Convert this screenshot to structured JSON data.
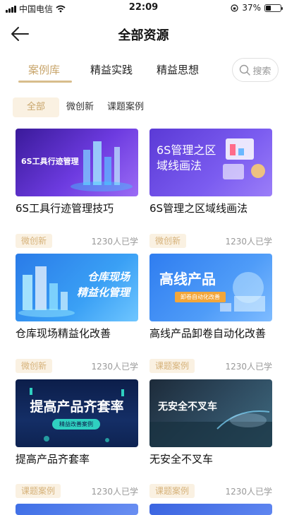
{
  "status_bar": {
    "carrier": "中国电信",
    "time": "22:09",
    "battery_pct": "37%",
    "battery_level": 0.37
  },
  "nav": {
    "title": "全部资源"
  },
  "tabs": [
    {
      "label": "案例库"
    },
    {
      "label": "精益实践"
    },
    {
      "label": "精益思想"
    }
  ],
  "search": {
    "placeholder": "搜索"
  },
  "filters": [
    {
      "label": "全部"
    },
    {
      "label": "微创新"
    },
    {
      "label": "课题案例"
    }
  ],
  "cards": [
    {
      "title": "6S工具行迹管理技巧",
      "thumb_text": "6S工具行迹管理",
      "tag": "",
      "learners": ""
    },
    {
      "title": "6S管理之区域线画法",
      "thumb_text": "6S管理之区\n域线画法",
      "tag": "",
      "learners": ""
    },
    {
      "title": "仓库现场精益化改善",
      "thumb_text": "仓库现场\n精益化管理",
      "tag": "微创新",
      "learners": "1230人已学"
    },
    {
      "title": "高线产品卸卷自动化改善",
      "thumb_text": "高线产品",
      "thumb_sub": "卸卷自动化改善",
      "tag": "微创新",
      "learners": "1230人已学"
    },
    {
      "title": "提高产品齐套率",
      "thumb_text": "提高产品齐套率",
      "thumb_sub": "精益改善案例",
      "tag": "微创新",
      "learners": "1230人已学"
    },
    {
      "title": "无安全不叉车",
      "thumb_text": "无安全不叉车",
      "tag": "课题案例",
      "learners": "1230人已学"
    },
    {
      "title": "",
      "thumb_text": "",
      "tag": "课题案例",
      "learners": "1230人已学"
    },
    {
      "title": "",
      "thumb_text": "",
      "tag": "课题案例",
      "learners": "1230人已学"
    }
  ],
  "colors": {
    "accent": "#c8a56b",
    "badge_bg": "#faf1e2",
    "badge_text": "#d6b27a"
  }
}
